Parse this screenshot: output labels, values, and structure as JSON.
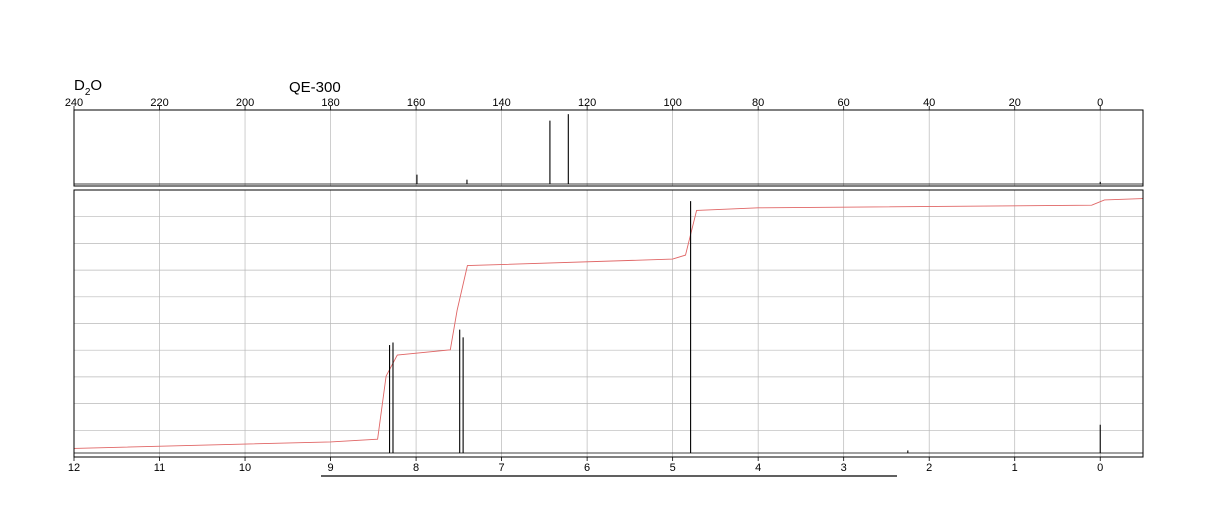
{
  "solvent": {
    "base": "D",
    "subscript": "2",
    "suffix": "O"
  },
  "instrument": "QE-300",
  "colors": {
    "trace": "#000000",
    "integral": "#e06666",
    "grid": "#b8b8b8",
    "frame": "#000000"
  },
  "chart_data": [
    {
      "type": "line",
      "name": "13C spectrum",
      "x_ticks": [
        "240",
        "220",
        "200",
        "180",
        "160",
        "140",
        "120",
        "100",
        "80",
        "60",
        "40",
        "20",
        "0"
      ],
      "xlim": [
        240,
        -10
      ],
      "axis_reversed": true,
      "grid": true,
      "peaks": [
        {
          "x": 159.8,
          "height": 0.13
        },
        {
          "x": 148.1,
          "height": 0.06
        },
        {
          "x": 128.7,
          "height": 0.88
        },
        {
          "x": 124.4,
          "height": 0.97
        },
        {
          "x": 0.0,
          "height": 0.03
        }
      ]
    },
    {
      "type": "line",
      "name": "1H spectrum",
      "x_ticks": [
        "12",
        "11",
        "10",
        "9",
        "8",
        "7",
        "6",
        "5",
        "4",
        "3",
        "2",
        "1",
        "0"
      ],
      "xlim": [
        12,
        -0.5
      ],
      "axis_reversed": true,
      "grid": true,
      "peaks": [
        {
          "x": 8.31,
          "height": 0.42
        },
        {
          "x": 8.27,
          "height": 0.43
        },
        {
          "x": 7.49,
          "height": 0.48
        },
        {
          "x": 7.45,
          "height": 0.45
        },
        {
          "x": 4.79,
          "height": 0.98
        },
        {
          "x": 2.25,
          "height": 0.01
        },
        {
          "x": 0.0,
          "height": 0.11
        }
      ],
      "integral": [
        {
          "x": 12.0,
          "y": 0.025
        },
        {
          "x": 9.0,
          "y": 0.05
        },
        {
          "x": 8.45,
          "y": 0.06
        },
        {
          "x": 8.35,
          "y": 0.3
        },
        {
          "x": 8.22,
          "y": 0.38
        },
        {
          "x": 7.6,
          "y": 0.4
        },
        {
          "x": 7.52,
          "y": 0.55
        },
        {
          "x": 7.4,
          "y": 0.72
        },
        {
          "x": 5.0,
          "y": 0.745
        },
        {
          "x": 4.85,
          "y": 0.76
        },
        {
          "x": 4.72,
          "y": 0.93
        },
        {
          "x": 4.0,
          "y": 0.94
        },
        {
          "x": 0.1,
          "y": 0.95
        },
        {
          "x": -0.05,
          "y": 0.97
        },
        {
          "x": -0.5,
          "y": 0.975
        }
      ]
    }
  ]
}
